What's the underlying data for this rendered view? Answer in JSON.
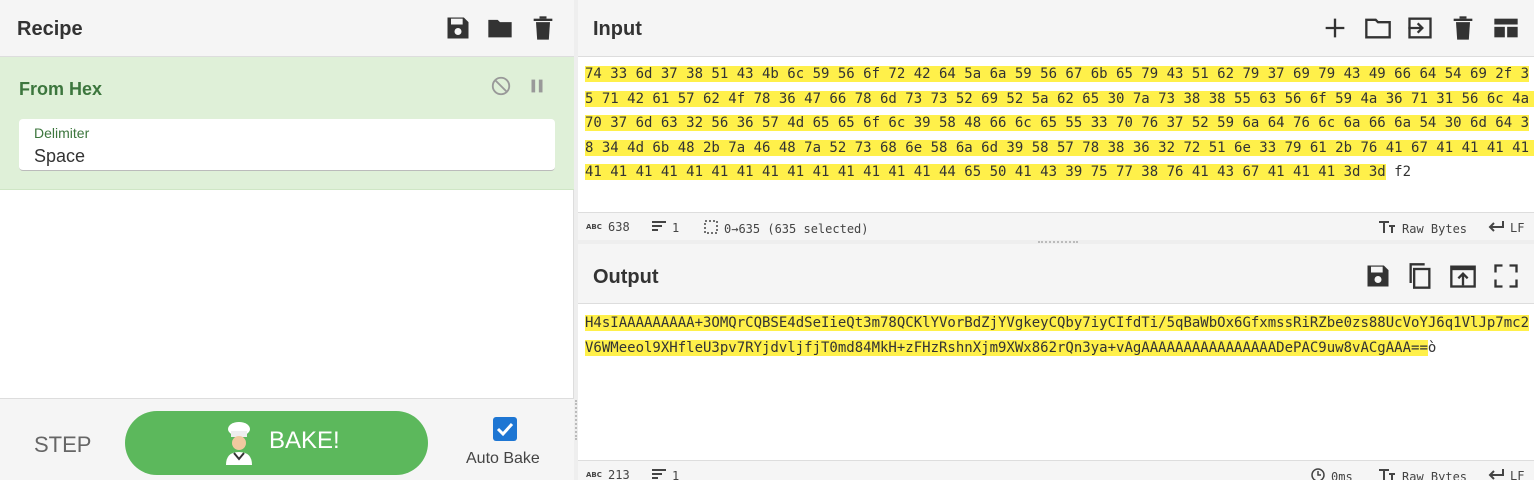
{
  "recipe": {
    "title": "Recipe",
    "icons": [
      "save-icon",
      "folder-icon",
      "trash-icon"
    ],
    "operation": {
      "name": "From Hex",
      "delimiter_label": "Delimiter",
      "delimiter_value": "Space"
    },
    "step_label": "STEP",
    "bake_label": "BAKE!",
    "auto_bake_label": "Auto Bake",
    "auto_bake_checked": true
  },
  "input": {
    "title": "Input",
    "icons": [
      "plus-icon",
      "folder-icon",
      "import-icon",
      "trash-icon",
      "layout-icon"
    ],
    "text_selected": "74 33 6d 37 38 51 43 4b 6c 59 56 6f 72 42 64 5a 6a 59 56 67 6b 65 79 43 51 62 79 37 69 79 43 49 66 64 54 69 2f 35 71 42 61 57 62 4f 78 36 47 66 78 6d 73 73 52 69 52 5a 62 65 30 7a 73 38 38 55 63 56 6f 59 4a 36 71 31 56 6c 4a 70 37 6d 63 32 56 36 57 4d 65 65 6f 6c 39 58 48 66 6c 65 55 33 70 76 37 52 59 6a 64 76 6c 6a 66 6a 54 30 6d 64 38 34 4d 6b 48 2b 7a 46 48 7a 52 73 68 6e 58 6a 6d 39 58 57 78 38 36 32 72 51 6e 33 79 61 2b 76 41 67 41 41 41 41 41 41 41 41 41 41 41 41 41 41 41 41 41 41 44 65 50 41 43 39 75 77 38 76 41 43 67 41 41 41 3d 3d",
    "text_rest": " f2",
    "status": {
      "length": "638",
      "lines": "1",
      "selection": "0→635 (635 selected)",
      "encoding": "Raw Bytes",
      "eol": "LF"
    }
  },
  "output": {
    "title": "Output",
    "icons": [
      "save-icon",
      "copy-icon",
      "replace-input-icon",
      "maximize-icon"
    ],
    "text_selected": "H4sIAAAAAAAAA+3OMQrCQBSE4dSeIieQt3m78QCKlYVorBdZjYVgkeyCQby7iyCIfdTi/5qBaWbOx6GfxmssRiRZbe0zs88UcVoYJ6q1VlJp7mc2V6WMeeol9XHfleU3pv7RYjdvljfjT0md84MkH+zFHzRshnXjm9XWx862rQn3ya+vAgAAAAAAAAAAAAAAAADePAC9uw8vACgAAA==",
    "text_rest": "ò",
    "status": {
      "length": "213",
      "lines": "1",
      "time": "0ms",
      "encoding": "Raw Bytes",
      "eol": "LF"
    }
  },
  "colors": {
    "accent_green": "#5cb85c",
    "op_background": "#dff0d8",
    "selection_highlight": "#fff04a",
    "checkbox_blue": "#1e76d3"
  }
}
